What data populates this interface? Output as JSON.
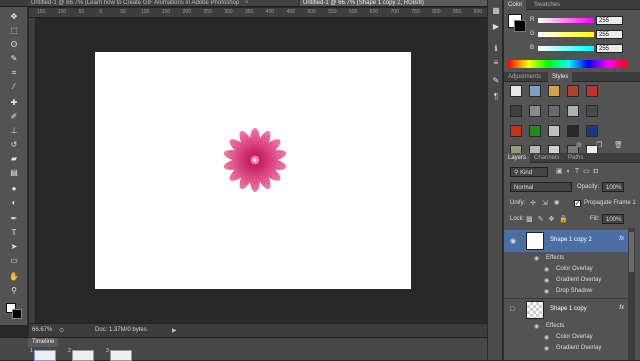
{
  "document_tabs": [
    {
      "label": "Untitled-1 @ 66.7% (Learn how to Create GIF Animations in Adobe Photoshop",
      "active": false
    },
    {
      "label": "Untitled-1 @ 66.7% (Shape 1 copy 2, RGB/8)",
      "active": true
    }
  ],
  "tab_close": "×",
  "ruler_ticks": [
    "150",
    "100",
    "50",
    "0",
    "50",
    "100",
    "150",
    "200",
    "250",
    "300",
    "350",
    "400",
    "450",
    "500",
    "550",
    "600",
    "650",
    "700",
    "750",
    "800",
    "850",
    "900"
  ],
  "status": {
    "zoom": "66.67%",
    "doc_size": "Doc: 1.37M/0 bytes",
    "arrow": "▶"
  },
  "timeline": {
    "tab": "Timeline",
    "frame_numbers": [
      "1",
      "2",
      "3"
    ]
  },
  "color_panel": {
    "tabs": [
      "Color",
      "Swatches"
    ],
    "channels": [
      {
        "label": "R",
        "value": "255",
        "gradient": "#ff00ff"
      },
      {
        "label": "G",
        "value": "255",
        "gradient": "#ffff00"
      },
      {
        "label": "B",
        "value": "255",
        "gradient": "#00ffff"
      }
    ]
  },
  "styles_panel": {
    "tabs": [
      "Adjustments",
      "Styles"
    ],
    "swatches": [
      "#e8e8e8",
      "#7aa0c8",
      "#d9a040",
      "#b04028",
      "#c83030",
      "#404040",
      "#8a8a8a",
      "#6a6a6a",
      "#b0b0b0",
      "#4a4a4a",
      "#c83010",
      "#208a20",
      "#c0c0c0",
      "#282828",
      "#1a3a80",
      "#9a9a7a",
      "#b8b8a8",
      "#d0d0d0",
      "#7a7a7a",
      "#eeeeee"
    ]
  },
  "layers_panel": {
    "tabs": [
      "Layers",
      "Channels",
      "Paths"
    ],
    "kind": "Kind",
    "blend_mode": "Normal",
    "opacity_label": "Opacity:",
    "opacity": "100%",
    "unify_label": "Unify:",
    "propagate": "Propagate Frame 1",
    "lock_label": "Lock:",
    "fill_label": "Fill:",
    "fill": "100%",
    "layers": [
      {
        "name": "Shape 1 copy 2",
        "fx": "fx",
        "selected": true,
        "effects_label": "Effects",
        "effects": [
          "Color Overlay",
          "Gradient Overlay",
          "Drop Shadow"
        ]
      },
      {
        "name": "Shape 1 copy",
        "fx": "fx",
        "selected": false,
        "effects_label": "Effects",
        "effects": [
          "Color Overlay",
          "Gradient Overlay",
          "Drop Shadow"
        ]
      }
    ]
  },
  "colors": {
    "flower_light": "#f27aa8",
    "flower_dark": "#c21a5e",
    "selection_blue": "#4b6fa4"
  }
}
